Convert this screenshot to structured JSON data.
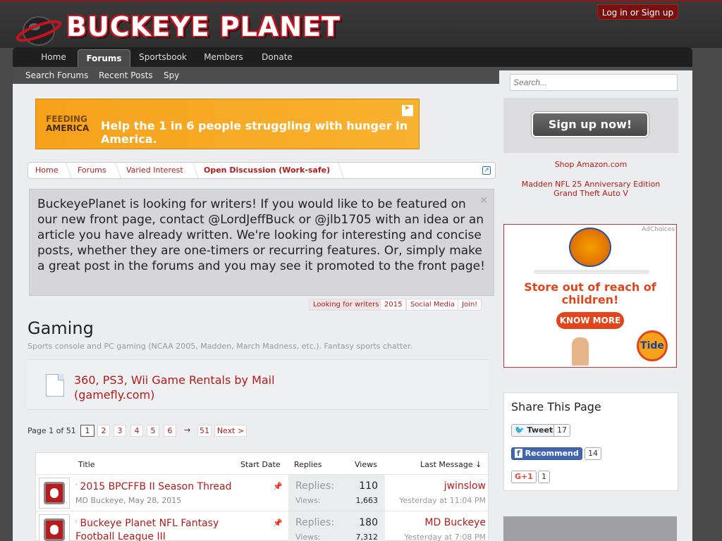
{
  "site": {
    "logo_text": "BUCKEYE PLANET",
    "login_label": "Log in or Sign up"
  },
  "nav": {
    "tabs": [
      "Home",
      "Forums",
      "Sportsbook",
      "Members",
      "Donate"
    ],
    "active": "Forums",
    "subnav": [
      "Search Forums",
      "Recent Posts",
      "Spy"
    ]
  },
  "ad_banner": {
    "brand_line1": "FEEDING",
    "brand_line2": "AMERICA",
    "message": "Help the 1 in 6 people struggling with hunger in America."
  },
  "breadcrumb": [
    "Home",
    "Forums",
    "Varied Interest",
    "Open Discussion (Work-safe)"
  ],
  "notice": {
    "text": "BuckeyePlanet is looking for writers! If you would like to be featured on our new front page, contact @LordJeffBuck or @jlb1705 with an idea or an article you have already written. We're looking for interesting and concise posts, whether they are one-timers or recurring features. Or, simply make a great post in the forums and you may see it promoted to the front page!",
    "tags": [
      "Looking for writers",
      "2015",
      "Social Media",
      "Join!"
    ]
  },
  "forum": {
    "title": "Gaming",
    "description": "Sports console and PC gaming (NCAA 2005, Madden, March Madness, etc.). Fantasy sports chatter.",
    "sticky_link": "360, PS3, Wii Game Rentals by Mail (gamefly.com)"
  },
  "pager": {
    "label": "Page 1 of 51",
    "pages": [
      "1",
      "2",
      "3",
      "4",
      "5",
      "6"
    ],
    "last": "51",
    "next": "Next >"
  },
  "thread_list": {
    "headers": {
      "title": "Title",
      "start_date": "Start Date",
      "replies": "Replies",
      "views": "Views",
      "last_message": "Last Message ↓"
    },
    "rows": [
      {
        "title": "2015 BPCFFB II Season Thread",
        "author": "MD Buckeye",
        "date": "May 28, 2015",
        "replies_label": "Replies:",
        "replies": "110",
        "views_label": "Views:",
        "views": "1,663",
        "last_user": "jwinslow",
        "last_date": "Yesterday at 11:04 PM"
      },
      {
        "title": "Buckeye Planet NFL Fantasy Football League III",
        "author": "",
        "date": "",
        "replies_label": "Replies:",
        "replies": "180",
        "views_label": "Views:",
        "views": "7,312",
        "last_user": "MD Buckeye",
        "last_date": "Yesterday at 7:08 PM"
      }
    ]
  },
  "sidebar": {
    "search_placeholder": "Search...",
    "signup_label": "Sign up now!",
    "links": [
      "Shop Amazon.com",
      "Madden NFL 25 Anniversary Edition",
      "Grand Theft Auto V"
    ],
    "ad": {
      "choices": "AdChoices",
      "headline": "Store out of reach of children!",
      "cta": "KNOW MORE",
      "brand": "Tide"
    },
    "share": {
      "title": "Share This Page",
      "tweet_label": "Tweet",
      "tweet_count": "17",
      "recommend_label": "Recommend",
      "recommend_count": "14",
      "gplus_label": "G+1",
      "gplus_count": "1"
    }
  },
  "colors": {
    "accent": "#b71919",
    "nav_bg": "#1f1f1f",
    "content_bg": "#ecedef"
  }
}
